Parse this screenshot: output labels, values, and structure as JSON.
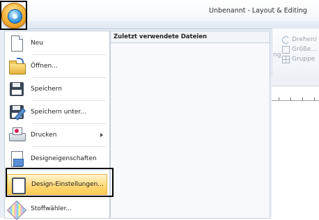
{
  "window": {
    "title": "Unbenannt - Layout & Editing"
  },
  "ribbon": {
    "commands": [
      {
        "label": "Drehen/",
        "icon": "rotate-icon"
      },
      {
        "label": "Größe...",
        "icon": "resize-icon"
      },
      {
        "label": "Gruppe",
        "icon": "group-icon"
      }
    ],
    "partial_label": "ng"
  },
  "app_menu": {
    "button_icon": "app-orb-icon",
    "recent_files_header": "Zuletzt verwendete Dateien",
    "items": [
      {
        "label": "Neu",
        "icon": "new-document-icon"
      },
      {
        "label": "Öffnen...",
        "icon": "open-folder-icon"
      },
      {
        "label": "Speichern",
        "icon": "save-icon"
      },
      {
        "label": "Speichern unter...",
        "icon": "save-as-icon"
      },
      {
        "label": "Drucken",
        "icon": "print-icon",
        "has_submenu": true
      },
      {
        "label": "Designeigenschaften",
        "icon": "design-properties-icon"
      },
      {
        "label": "Design-Einstellungen...",
        "icon": "design-settings-icon",
        "highlighted": true
      },
      {
        "label": "Stoffwähler...",
        "icon": "fabric-selector-icon"
      }
    ]
  },
  "colors": {
    "highlight_gradient_top": "#fff5cf",
    "highlight_gradient_bottom": "#ffcb52",
    "orb_orange": "#f5b53a",
    "orb_blue": "#3fa0e8",
    "callout_border": "#000000"
  }
}
